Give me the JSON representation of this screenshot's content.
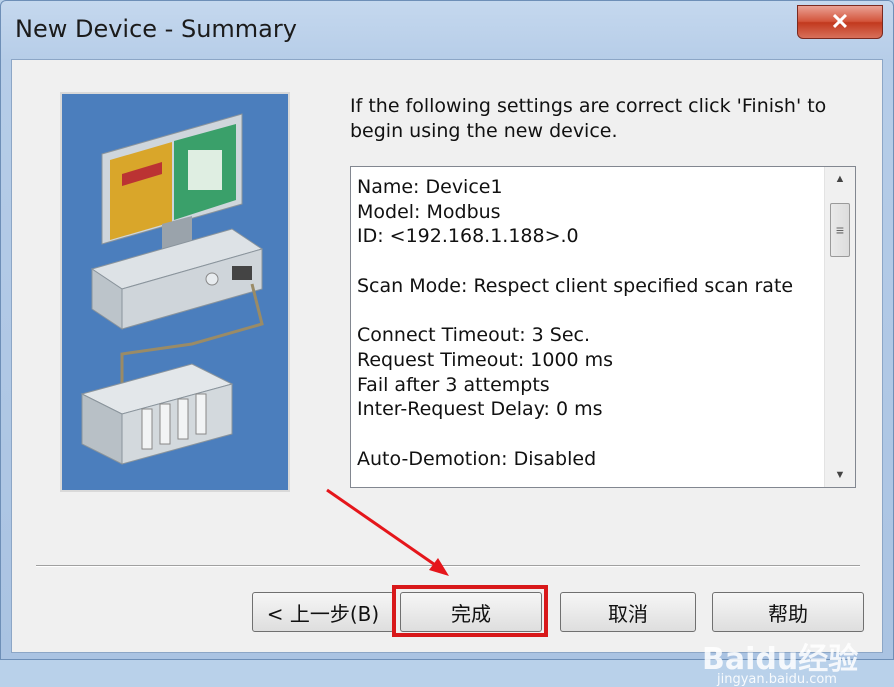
{
  "window": {
    "title": "New Device - Summary",
    "close_glyph": "✕"
  },
  "intro": "If the following settings are correct click 'Finish' to begin using the new device.",
  "summary_lines": [
    "Name: Device1",
    "Model: Modbus",
    "ID: <192.168.1.188>.0",
    "",
    "Scan Mode: Respect client specified scan rate",
    "",
    "Connect Timeout: 3 Sec.",
    "Request Timeout: 1000 ms",
    "Fail after 3 attempts",
    "Inter-Request Delay: 0 ms",
    "",
    "Auto-Demotion: Disabled"
  ],
  "buttons": {
    "back": "< 上一步(B)",
    "finish": "完成",
    "cancel": "取消",
    "help": "帮助"
  },
  "watermark": {
    "main": "Baidu经验",
    "sub": "jingyan.baidu.com"
  },
  "colors": {
    "highlight": "#d8181a",
    "illustration_bg": "#4b7ebd"
  },
  "icons": {
    "scroll_up": "up-arrow-icon",
    "scroll_down": "down-arrow-icon",
    "close": "close-icon"
  }
}
